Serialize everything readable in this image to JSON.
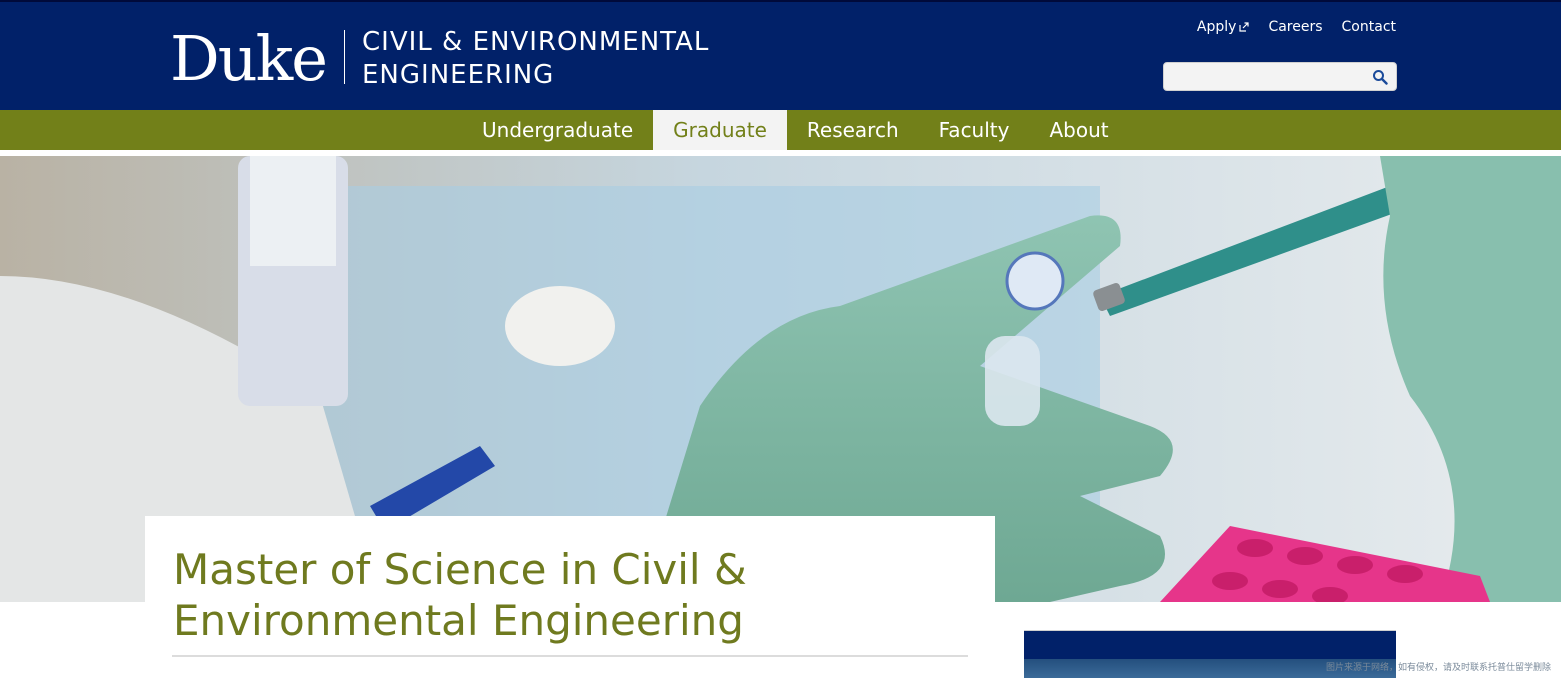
{
  "header": {
    "logo": "Duke",
    "department_line1": "CIVIL & ENVIRONMENTAL",
    "department_line2": "ENGINEERING",
    "utility_links": [
      {
        "label": "Apply",
        "external": true
      },
      {
        "label": "Careers"
      },
      {
        "label": "Contact"
      }
    ],
    "search": {
      "placeholder": "",
      "icon": "search-icon"
    }
  },
  "nav": {
    "items": [
      "Undergraduate",
      "Graduate",
      "Research",
      "Faculty",
      "About"
    ],
    "active": "Graduate"
  },
  "hero": {
    "image_subject": "lab gloves holding a microtube and pipette"
  },
  "page": {
    "title": "Master of Science in Civil & Environmental Engineering"
  },
  "watermark": "图片来源于网络，如有侵权，请及时联系托普仕留学删除",
  "colors": {
    "duke_blue": "#012169",
    "nav_olive": "#728019",
    "title_olive": "#6f7a1f"
  }
}
